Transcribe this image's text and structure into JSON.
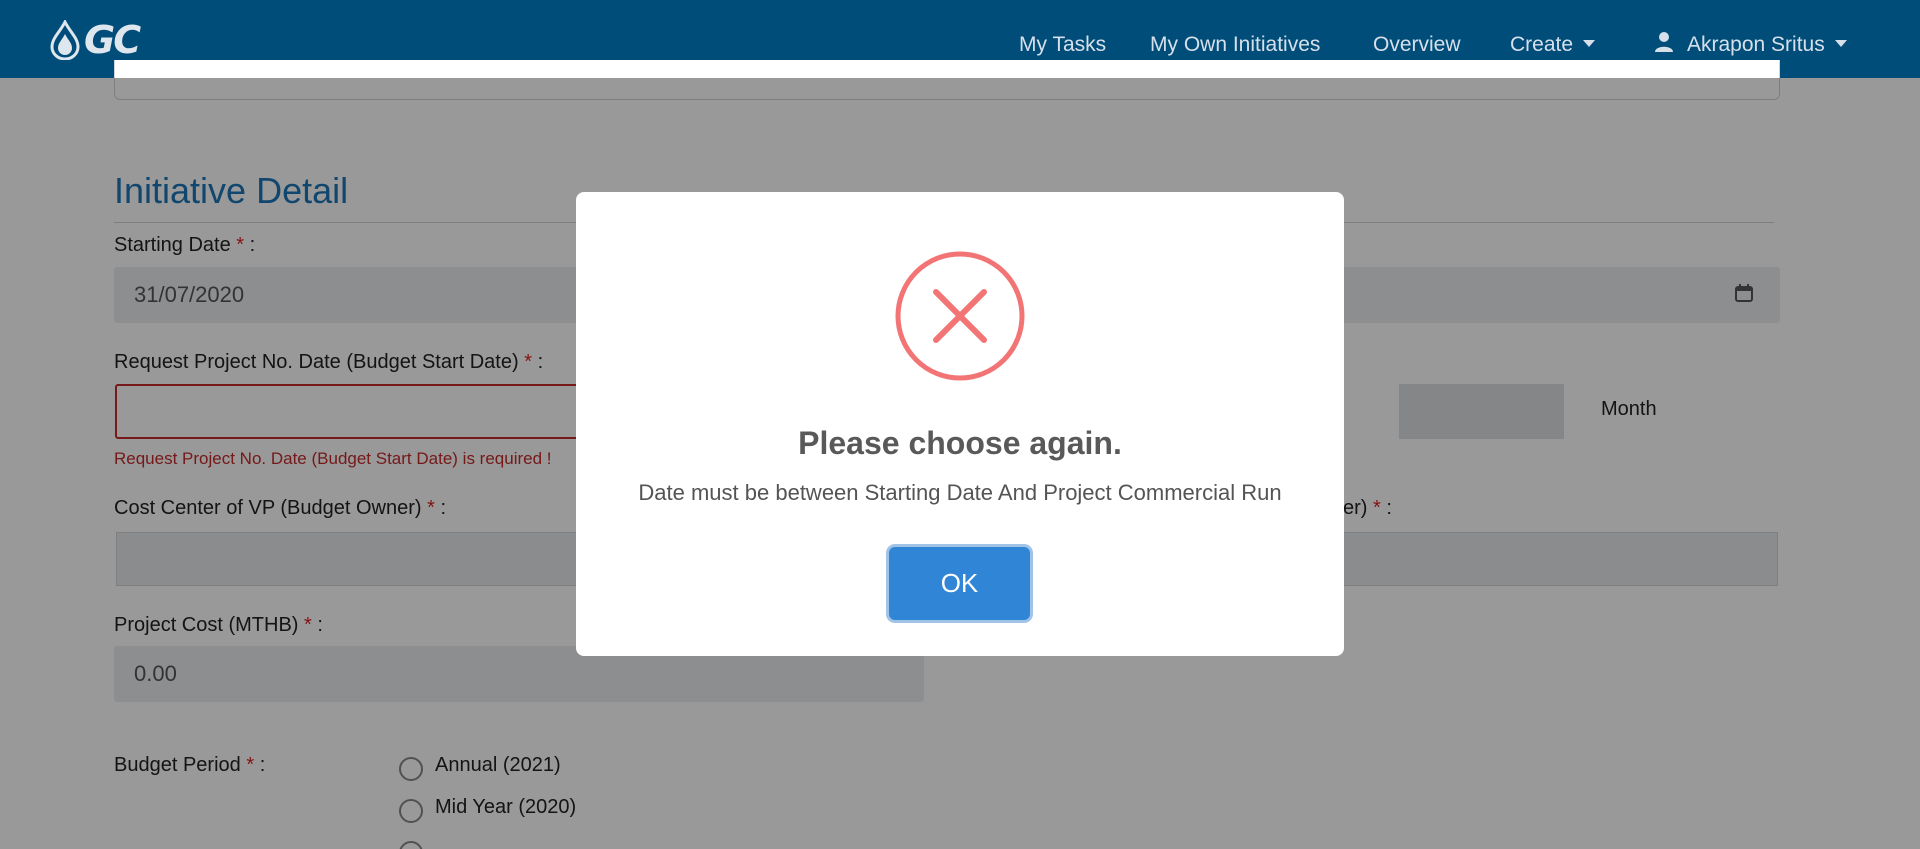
{
  "brand": {
    "logo_text": "GC",
    "logo_color": "#dfe7ee"
  },
  "navbar": {
    "background": "#004d7a",
    "items": [
      {
        "label": "My Tasks"
      },
      {
        "label": "My Own Initiatives"
      },
      {
        "label": "Overview"
      },
      {
        "label": "Create"
      }
    ],
    "user_name": "Akrapon Sritus"
  },
  "form": {
    "section_title": "Initiative Detail",
    "starting_date": {
      "label": "Starting Date",
      "required_mark": "*",
      "suffix": ":",
      "value": "31/07/2020"
    },
    "request_date": {
      "label": "Request Project No. Date (Budget Start Date)",
      "required_mark": "*",
      "suffix": ":",
      "error": "Request Project No. Date (Budget Start Date) is required !"
    },
    "duration_unit": "Month",
    "cost_center": {
      "label": "Cost Center of VP (Budget Owner)",
      "required_mark": "*",
      "suffix": ":"
    },
    "right_partial_label": {
      "text": "er)",
      "required_mark": "*",
      "suffix": ":"
    },
    "project_cost": {
      "label": "Project Cost (MTHB)",
      "required_mark": "*",
      "suffix": ":",
      "value": "0.00"
    },
    "budget_period": {
      "label": "Budget Period",
      "required_mark": "*",
      "suffix": ":",
      "options": [
        "Annual (2021)",
        "Mid Year (2020)"
      ]
    }
  },
  "modal": {
    "icon": "error-x-icon",
    "icon_color": "#f27474",
    "title": "Please choose again.",
    "message": "Date must be between Starting Date And Project Commercial Run",
    "ok_label": "OK",
    "ok_color": "#3085d6"
  }
}
